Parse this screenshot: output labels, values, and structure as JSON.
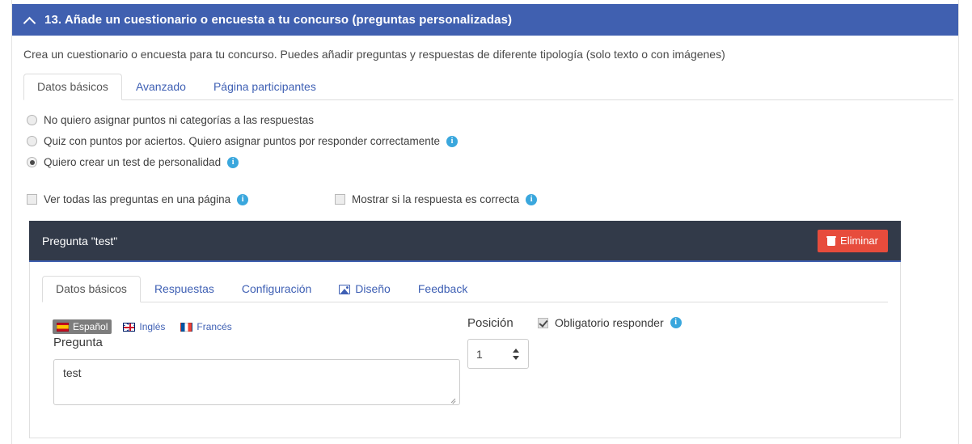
{
  "accordion": {
    "title": "13. Añade un cuestionario o encuesta a tu concurso (preguntas personalizadas)",
    "chevron_icon": "chevron-up-icon",
    "header_color": "#4060b0"
  },
  "intro": {
    "text": "Crea un cuestionario o encuesta para tu concurso. Puedes añadir preguntas y respuestas de diferente tipología (solo texto o con imágenes)"
  },
  "outer_tabs": [
    {
      "label": "Datos básicos",
      "active": true
    },
    {
      "label": "Avanzado",
      "active": false
    },
    {
      "label": "Página participantes",
      "active": false
    }
  ],
  "scoring_options": [
    {
      "label": "No quiero asignar puntos ni categorías a las respuestas",
      "checked": false,
      "info": false
    },
    {
      "label": "Quiz con puntos por aciertos. Quiero asignar puntos por responder correctamente",
      "checked": false,
      "info": true
    },
    {
      "label": "Quiero crear un test de personalidad",
      "checked": true,
      "info": true
    }
  ],
  "display_options": [
    {
      "label": "Ver todas las preguntas en una página",
      "checked": false,
      "info": true
    },
    {
      "label": "Mostrar si la respuesta es correcta",
      "checked": false,
      "info": true
    }
  ],
  "question_card": {
    "header_title": "Pregunta \"test\"",
    "header_color": "#323a49",
    "accent_color": "#4060b0",
    "delete_button": {
      "label": "Eliminar",
      "icon": "trash-icon",
      "color": "#e74c3c"
    },
    "tabs": [
      {
        "label": "Datos básicos",
        "active": true,
        "icon": null
      },
      {
        "label": "Respuestas",
        "active": false,
        "icon": null
      },
      {
        "label": "Configuración",
        "active": false,
        "icon": null
      },
      {
        "label": "Diseño",
        "active": false,
        "icon": "picture-icon"
      },
      {
        "label": "Feedback",
        "active": false,
        "icon": null
      }
    ],
    "languages": [
      {
        "label": "Español",
        "flag": "flag-es",
        "active": true
      },
      {
        "label": "Inglés",
        "flag": "flag-gb",
        "active": false
      },
      {
        "label": "Francés",
        "flag": "flag-fr",
        "active": false
      }
    ],
    "pregunta": {
      "label": "Pregunta",
      "value": "test",
      "placeholder": ""
    },
    "posicion": {
      "label": "Posición",
      "value": "1"
    },
    "obligatorio": {
      "label": "Obligatorio responder",
      "checked": true,
      "info": true
    }
  },
  "icons": {
    "info": "i"
  }
}
